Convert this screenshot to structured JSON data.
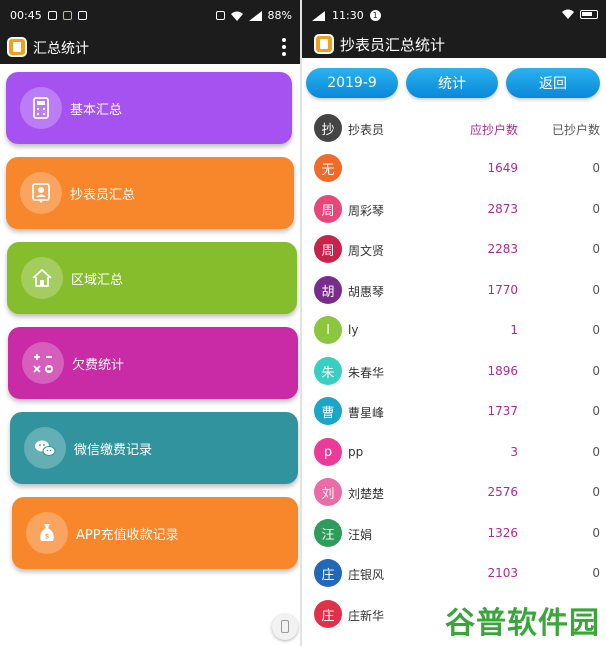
{
  "left": {
    "status": {
      "time": "00:45",
      "battery": "88%"
    },
    "title": "汇总统计",
    "menu": [
      {
        "label": "基本汇总",
        "icon": "calculator-icon",
        "color": "#a552f0"
      },
      {
        "label": "抄表员汇总",
        "icon": "contact-card-icon",
        "color": "#f8862a"
      },
      {
        "label": "区域汇总",
        "icon": "home-icon",
        "color": "#86bd2c"
      },
      {
        "label": "欠费统计",
        "icon": "math-symbols-icon",
        "color": "#c92aa6"
      },
      {
        "label": "微信缴费记录",
        "icon": "wechat-icon",
        "color": "#30939d"
      },
      {
        "label": "APP充值收款记录",
        "icon": "money-bag-icon",
        "color": "#f8862a"
      }
    ]
  },
  "right": {
    "status": {
      "time": "11:30",
      "notif": "1"
    },
    "title": "抄表员汇总统计",
    "buttons": {
      "month": "2019-9",
      "stats": "统计",
      "back": "返回"
    },
    "header": {
      "avatar": "抄",
      "name": "抄表员",
      "due": "应抄户数",
      "done": "已抄户数"
    },
    "rows": [
      {
        "avatar": "无",
        "name": "",
        "due": "1649",
        "done": "0",
        "color": "#f06a2a"
      },
      {
        "avatar": "周",
        "name": "周彩琴",
        "due": "2873",
        "done": "0",
        "color": "#e8477a"
      },
      {
        "avatar": "周",
        "name": "周文贤",
        "due": "2283",
        "done": "0",
        "color": "#c8234a"
      },
      {
        "avatar": "胡",
        "name": "胡惠琴",
        "due": "1770",
        "done": "0",
        "color": "#7a2c8c"
      },
      {
        "avatar": "l",
        "name": "ly",
        "due": "1",
        "done": "0",
        "color": "#8cc63e"
      },
      {
        "avatar": "朱",
        "name": "朱春华",
        "due": "1896",
        "done": "0",
        "color": "#36cfc2"
      },
      {
        "avatar": "曹",
        "name": "曹星峰",
        "due": "1737",
        "done": "0",
        "color": "#1ba6c8"
      },
      {
        "avatar": "p",
        "name": "pp",
        "due": "3",
        "done": "0",
        "color": "#ec3a98"
      },
      {
        "avatar": "刘",
        "name": "刘楚楚",
        "due": "2576",
        "done": "0",
        "color": "#ec6aa6"
      },
      {
        "avatar": "汪",
        "name": "汪娟",
        "due": "1326",
        "done": "0",
        "color": "#2e9c5a"
      },
      {
        "avatar": "庄",
        "name": "庄银风",
        "due": "2103",
        "done": "0",
        "color": "#2168b8"
      },
      {
        "avatar": "庄",
        "name": "庄新华",
        "due": "",
        "done": "",
        "color": "#e0304a"
      }
    ],
    "header_avatar_color": "#444444"
  },
  "watermark": "谷普软件园"
}
